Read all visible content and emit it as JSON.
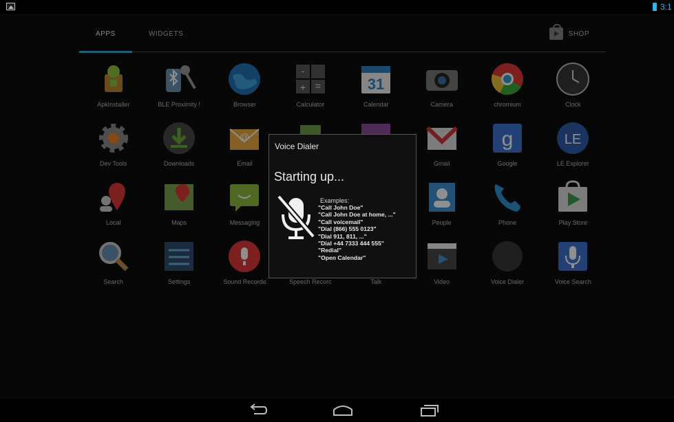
{
  "status_bar": {
    "left_icon": "gallery-notification-icon",
    "battery_icon": "battery-icon",
    "clock": "3:1",
    "accent": "#33b5e5"
  },
  "drawer": {
    "tabs": [
      {
        "label": "APPS",
        "selected": true
      },
      {
        "label": "WIDGETS",
        "selected": false
      }
    ],
    "shop_label": "SHOP",
    "apps": [
      {
        "label": "ApkInstaller",
        "icon": "android-package-icon"
      },
      {
        "label": "BLE Proximity !",
        "icon": "bluetooth-key-icon"
      },
      {
        "label": "Browser",
        "icon": "globe-icon"
      },
      {
        "label": "Calculator",
        "icon": "calculator-icon"
      },
      {
        "label": "Calendar",
        "icon": "calendar-icon"
      },
      {
        "label": "Camera",
        "icon": "camera-icon"
      },
      {
        "label": "chromium",
        "icon": "chromium-icon"
      },
      {
        "label": "Clock",
        "icon": "clock-icon"
      },
      {
        "label": "Dev Tools",
        "icon": "gear-icon"
      },
      {
        "label": "Downloads",
        "icon": "download-icon"
      },
      {
        "label": "Email",
        "icon": "email-icon"
      },
      {
        "label": "",
        "icon": "gallery-icon"
      },
      {
        "label": "",
        "icon": "photo-icon"
      },
      {
        "label": "Gmail",
        "icon": "gmail-icon"
      },
      {
        "label": "Google",
        "icon": "google-icon"
      },
      {
        "label": "LE Explorer",
        "icon": "le-explorer-icon"
      },
      {
        "label": "Local",
        "icon": "map-pin-icon"
      },
      {
        "label": "Maps",
        "icon": "maps-icon"
      },
      {
        "label": "Messaging",
        "icon": "messaging-icon"
      },
      {
        "label": "",
        "icon": "music-icon"
      },
      {
        "label": "",
        "icon": "news-icon"
      },
      {
        "label": "People",
        "icon": "people-icon"
      },
      {
        "label": "Phone",
        "icon": "phone-icon"
      },
      {
        "label": "Play Store",
        "icon": "play-store-icon"
      },
      {
        "label": "Search",
        "icon": "search-icon"
      },
      {
        "label": "Settings",
        "icon": "settings-icon"
      },
      {
        "label": "Sound Recorde",
        "icon": "sound-recorder-icon"
      },
      {
        "label": "Speech Recorc",
        "icon": "speech-recorder-icon"
      },
      {
        "label": "Talk",
        "icon": "talk-icon"
      },
      {
        "label": "Video",
        "icon": "video-icon"
      },
      {
        "label": "Voice Dialer",
        "icon": "voice-dialer-icon"
      },
      {
        "label": "Voice Search",
        "icon": "voice-search-icon"
      }
    ]
  },
  "dialog": {
    "title": "Voice Dialer",
    "status": "Starting up...",
    "examples_heading": "Examples:",
    "examples": [
      "\"Call John Doe\"",
      "\"Call John Doe at home, ...\"",
      "\"Call voicemail\"",
      "\"Dial (866) 555 0123\"",
      "\"Dial 911, 811, ...\"",
      "\"Dial +44 7333 444 555\"",
      "\"Redial\"",
      "\"Open Calendar\""
    ],
    "icon": "microphone-muted-icon"
  },
  "navbar": {
    "back_icon": "back-icon",
    "home_icon": "home-icon",
    "recents_icon": "recents-icon"
  }
}
